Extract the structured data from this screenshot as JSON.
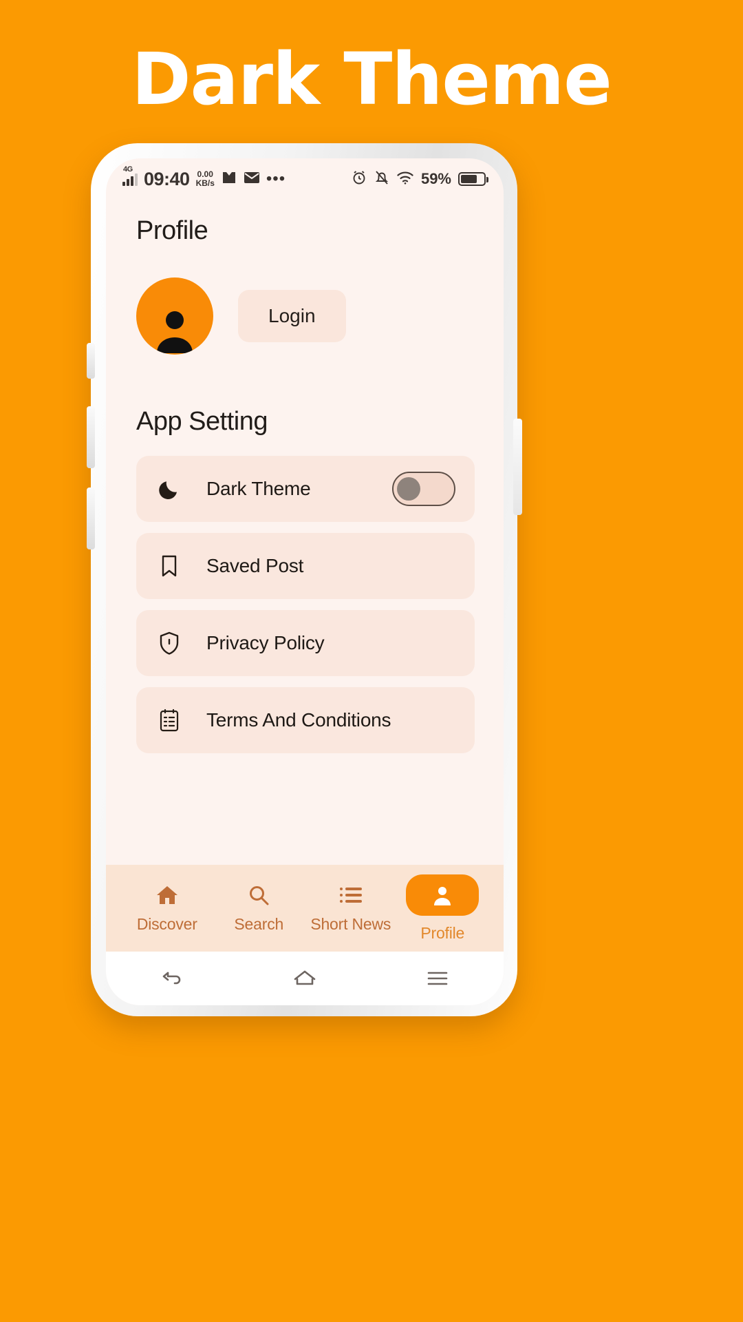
{
  "banner": {
    "title": "Dark Theme"
  },
  "theme": {
    "brand_orange": "#FB9A02",
    "accent_orange": "#F98B07",
    "screen_bg": "#FDF3EF",
    "row_bg": "#FAE7DE",
    "tabbar_bg": "#FAE4D3",
    "tab_label": "#BE6D37",
    "text_dark": "#1E1915"
  },
  "statusbar": {
    "network_type": "4G",
    "signal_icon": "signal-bars-icon",
    "time": "09:40",
    "net_speed_value": "0.00",
    "net_speed_unit": "KB/s",
    "app_icons": [
      "inbox-icon",
      "mail-icon"
    ],
    "overflow": "•••",
    "alarm_icon": "alarm-clock-icon",
    "bell_icon": "bell-muted-icon",
    "wifi_icon": "wifi-icon",
    "battery_percent": "59%",
    "battery_icon": "battery-icon"
  },
  "page": {
    "title": "Profile",
    "avatar_icon": "person-avatar-icon",
    "login_label": "Login",
    "section_title": "App Setting"
  },
  "settings": [
    {
      "label": "Dark Theme",
      "icon": "moon-icon",
      "has_toggle": true,
      "toggle_state": "off"
    },
    {
      "label": "Saved Post",
      "icon": "bookmark-icon",
      "has_toggle": false
    },
    {
      "label": "Privacy Policy",
      "icon": "shield-check-icon",
      "has_toggle": false
    },
    {
      "label": "Terms And Conditions",
      "icon": "clipboard-list-icon",
      "has_toggle": false
    }
  ],
  "tabs": [
    {
      "label": "Discover",
      "icon": "home-icon",
      "active": false
    },
    {
      "label": "Search",
      "icon": "search-icon",
      "active": false
    },
    {
      "label": "Short News",
      "icon": "list-icon",
      "active": false
    },
    {
      "label": "Profile",
      "icon": "person-icon",
      "active": true
    }
  ],
  "android_nav": {
    "back_icon": "back-arrow-icon",
    "home_icon": "home-outline-icon",
    "menu_icon": "hamburger-menu-icon"
  }
}
